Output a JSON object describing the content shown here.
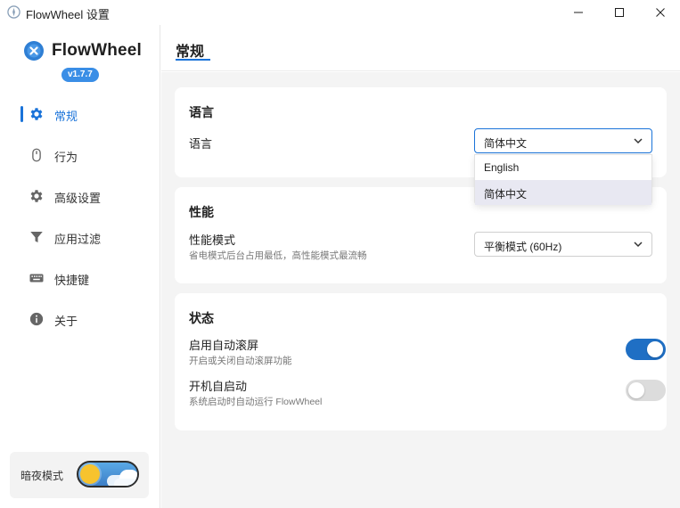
{
  "window": {
    "title": "FlowWheel 设置",
    "minimize_glyph": "—",
    "maximize_glyph": "☐",
    "close_glyph": "✕"
  },
  "brand": {
    "name": "FlowWheel",
    "version": "v1.7.7",
    "accent": "#1a73d9"
  },
  "sidebar": {
    "items": [
      {
        "label": "常规",
        "icon": "gear-icon",
        "active": true
      },
      {
        "label": "行为",
        "icon": "mouse-icon",
        "active": false
      },
      {
        "label": "高级设置",
        "icon": "gear-icon",
        "active": false
      },
      {
        "label": "应用过滤",
        "icon": "filter-icon",
        "active": false
      },
      {
        "label": "快捷键",
        "icon": "keyboard-icon",
        "active": false
      },
      {
        "label": "关于",
        "icon": "info-icon",
        "active": false
      }
    ],
    "dark_mode": {
      "label": "暗夜模式",
      "on": false
    }
  },
  "header": {
    "title": "常规"
  },
  "sections": {
    "language": {
      "title": "语言",
      "label": "语言",
      "selected": "简体中文",
      "options": [
        "English",
        "简体中文"
      ]
    },
    "performance": {
      "title": "性能",
      "label": "性能模式",
      "description": "省电模式后台占用最低，高性能模式最流畅",
      "selected": "平衡模式 (60Hz)"
    },
    "status": {
      "title": "状态",
      "auto_scroll": {
        "label": "启用自动滚屏",
        "description": "开启或关闭自动滚屏功能",
        "on": true
      },
      "autostart": {
        "label": "开机自启动",
        "description": "系统启动时自动运行 FlowWheel",
        "on": false
      }
    }
  }
}
